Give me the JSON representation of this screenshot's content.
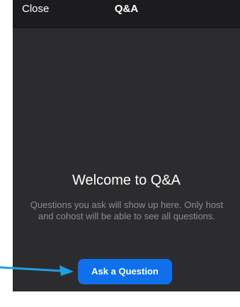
{
  "header": {
    "close_label": "Close",
    "title": "Q&A"
  },
  "main": {
    "welcome_title": "Welcome to Q&A",
    "description": "Questions you ask will show up here. Only host and cohost will be able to see all questions.",
    "ask_button_label": "Ask a Question"
  },
  "colors": {
    "header_bg": "#1c1c1e",
    "body_bg": "#2c2c2e",
    "accent": "#0e71eb",
    "annotation_arrow": "#1ba1e2"
  },
  "icons": {
    "annotation": "arrow-right-icon"
  }
}
